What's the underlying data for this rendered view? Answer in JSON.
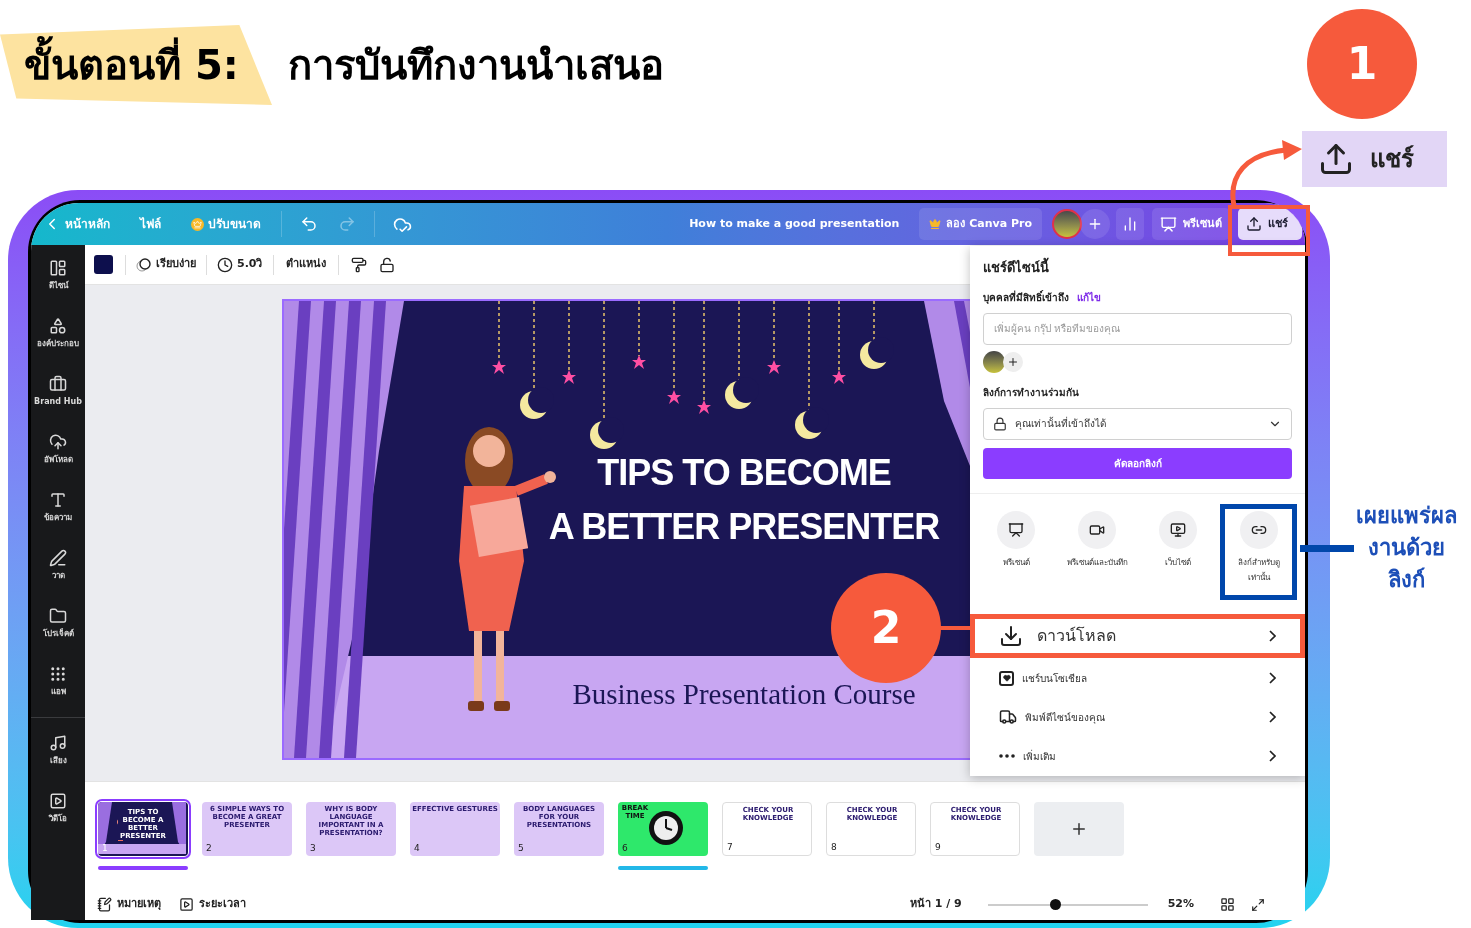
{
  "heading": {
    "step": "ขั้นตอนที่ 5:",
    "title": "การบันทึกงานนำเสนอ"
  },
  "callouts": [
    {
      "number": "1"
    },
    {
      "number": "2"
    }
  ],
  "share_zoom": {
    "label": "แชร์"
  },
  "side_note": {
    "lines": [
      "เผยแพร่ผล",
      "งานด้วย",
      "ลิงก์"
    ]
  },
  "app": {
    "topbar": {
      "back": "หน้าหลัก",
      "file": "ไฟล์",
      "resize": "ปรับขนาด",
      "doc_title": "How to make a good presentation",
      "pro": "ลอง Canva Pro",
      "present": "พรีเซนต์",
      "share": "แชร์"
    },
    "sidebar": [
      {
        "label": "ดีไซน์"
      },
      {
        "label": "องค์ประกอบ"
      },
      {
        "label": "Brand Hub"
      },
      {
        "label": "อัพโหลด"
      },
      {
        "label": "ข้อความ"
      },
      {
        "label": "วาด"
      },
      {
        "label": "โปรเจ็คต์"
      },
      {
        "label": "แอพ"
      },
      {
        "label": "เสียง"
      },
      {
        "label": "วิดีโอ"
      }
    ],
    "toolbar": {
      "animation": "เรียบง่าย",
      "duration": "5.0วิ",
      "position": "ตำแหน่ง"
    },
    "slide": {
      "title_lines": [
        "TIPS TO BECOME",
        "A BETTER PRESENTER"
      ],
      "subtitle": "Business Presentation Course"
    },
    "share_panel": {
      "title": "แชร์ดีไซน์นี้",
      "access_label": "บุคคลที่มีสิทธิ์เข้าถึง",
      "edit_link": "แก้ไข",
      "people_placeholder": "เพิ่มผู้คน กรุ๊ป หรือทีมของคุณ",
      "collab_label": "ลิงก์การทำงานร่วมกัน",
      "access_value": "คุณเท่านั้นที่เข้าถึงได้",
      "copy_button": "คัดลอกลิงก์",
      "options": [
        {
          "label": "พรีเซนต์",
          "highlighted": false
        },
        {
          "label": "พรีเซนต์และบันทึก",
          "highlighted": false
        },
        {
          "label": "เว็บไซต์",
          "highlighted": false
        },
        {
          "label": "ลิงก์สำหรับดูเท่านั้น",
          "highlighted": true
        }
      ],
      "menu": [
        {
          "label": "ดาวน์โหลด",
          "highlighted": true
        },
        {
          "label": "แชร์บนโซเชียล",
          "highlighted": false
        },
        {
          "label": "พิมพ์ดีไซน์ของคุณ",
          "highlighted": false
        },
        {
          "label": "เพิ่มเติม",
          "highlighted": false
        }
      ]
    },
    "thumbnails": [
      {
        "number": "1",
        "title": "TIPS TO BECOME A BETTER PRESENTER",
        "kind": "stage",
        "selected": true,
        "marked": false
      },
      {
        "number": "2",
        "title": "6 SIMPLE WAYS TO BECOME A GREAT PRESENTER",
        "kind": "lavender",
        "selected": false,
        "marked": false
      },
      {
        "number": "3",
        "title": "WHY IS BODY LANGUAGE IMPORTANT IN A PRESENTATION?",
        "kind": "lavender",
        "selected": false,
        "marked": false
      },
      {
        "number": "4",
        "title": "EFFECTIVE GESTURES",
        "kind": "lavender",
        "selected": false,
        "marked": false
      },
      {
        "number": "5",
        "title": "BODY LANGUAGES FOR YOUR PRESENTATIONS",
        "kind": "lavender",
        "selected": false,
        "marked": false
      },
      {
        "number": "6",
        "title": "BREAK TIME",
        "kind": "break",
        "selected": false,
        "marked": true
      },
      {
        "number": "7",
        "title": "CHECK YOUR KNOWLEDGE",
        "kind": "quiz",
        "selected": false,
        "marked": false
      },
      {
        "number": "8",
        "title": "CHECK YOUR KNOWLEDGE",
        "kind": "quiz",
        "selected": false,
        "marked": false
      },
      {
        "number": "9",
        "title": "CHECK YOUR KNOWLEDGE",
        "kind": "quiz",
        "selected": false,
        "marked": false
      }
    ],
    "status_bar": {
      "notes": "หมายเหตุ",
      "timer": "ระยะเวลา",
      "page": "หน้า 1 / 9",
      "zoom": "52%",
      "zoom_slider": {
        "level": 0.42
      }
    }
  }
}
